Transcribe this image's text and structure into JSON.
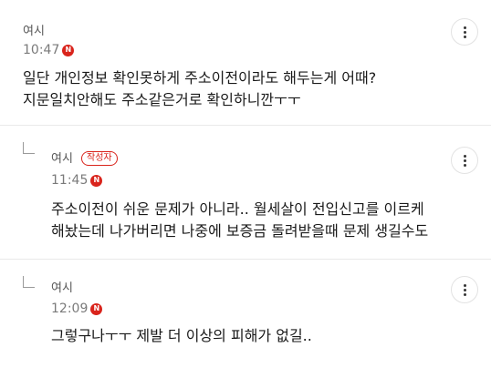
{
  "comments": [
    {
      "author": "여시",
      "time": "10:47",
      "new_badge": "N",
      "lines": [
        "일단 개인정보 확인못하게 주소이전이라도 해두는게 어때?",
        "지문일치안해도 주소같은거로 확인하니깐ㅜㅜ"
      ]
    },
    {
      "author": "여시",
      "writer_badge": "작성자",
      "time": "11:45",
      "new_badge": "N",
      "lines": [
        "주소이전이 쉬운 문제가 아니라.. 월세살이 전입신고를 이르케",
        "해놨는데 나가버리면 나중에 보증금 돌려받을때 문제 생길수도"
      ]
    },
    {
      "author": "여시",
      "time": "12:09",
      "new_badge": "N",
      "lines": [
        "그렇구나ㅜㅜ 제발 더 이상의 피해가 없길.."
      ]
    }
  ]
}
